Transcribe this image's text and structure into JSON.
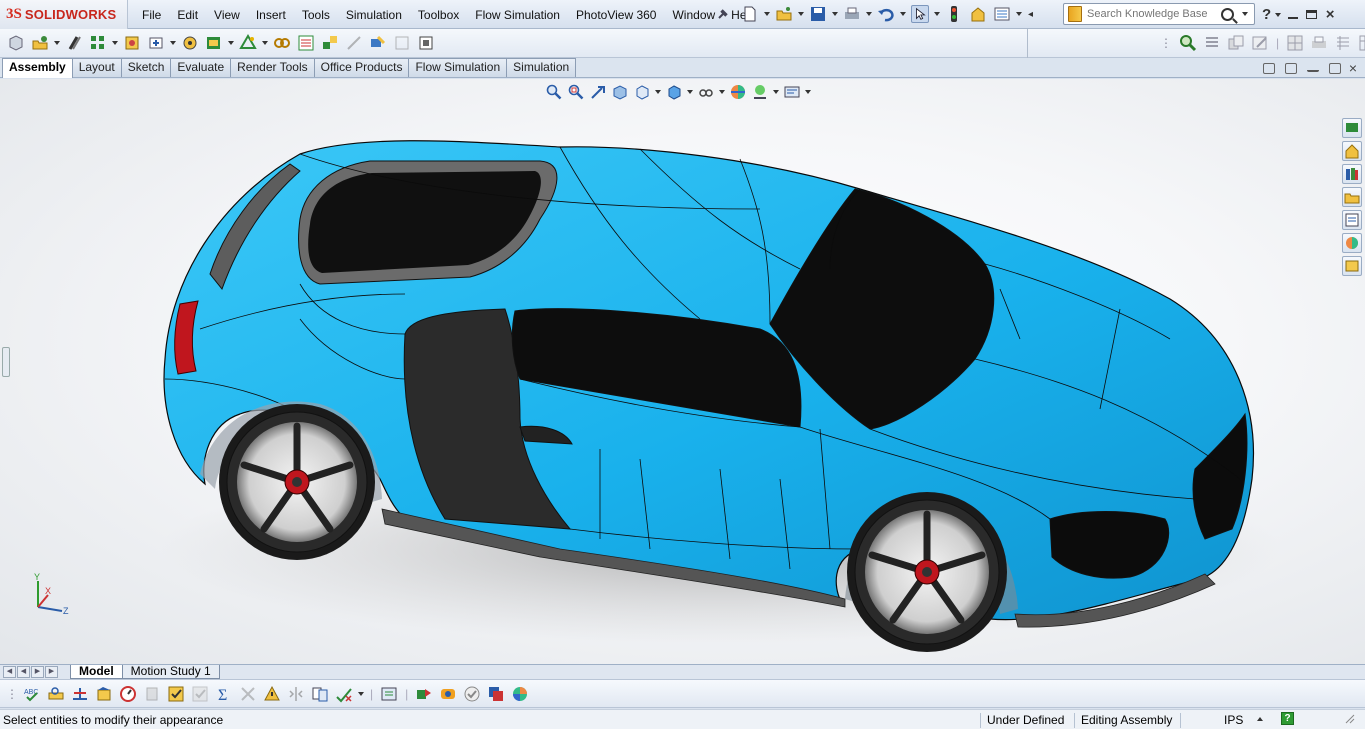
{
  "app": {
    "logo_ds": "3S",
    "logo_text": "SOLIDWORKS"
  },
  "menu": [
    "File",
    "Edit",
    "View",
    "Insert",
    "Tools",
    "Simulation",
    "Toolbox",
    "Flow Simulation",
    "PhotoView 360",
    "Window",
    "Help"
  ],
  "search": {
    "placeholder": "Search Knowledge Base"
  },
  "tabs": [
    "Assembly",
    "Layout",
    "Sketch",
    "Evaluate",
    "Render Tools",
    "Office Products",
    "Flow Simulation",
    "Simulation"
  ],
  "active_tab": "Assembly",
  "bottom_tabs": [
    "Model",
    "Motion Study 1"
  ],
  "active_bottom_tab": "Model",
  "triad": {
    "x": "X",
    "y": "Y",
    "z": "Z"
  },
  "status": {
    "message": "Select entities to modify their appearance",
    "state": "Under Defined",
    "mode": "Editing Assembly",
    "units": "IPS",
    "help": "?"
  },
  "colors": {
    "car_body": "#1fb4ec",
    "glass": "#111111",
    "taillight": "#c0161e",
    "brand": "#d52b1e"
  }
}
